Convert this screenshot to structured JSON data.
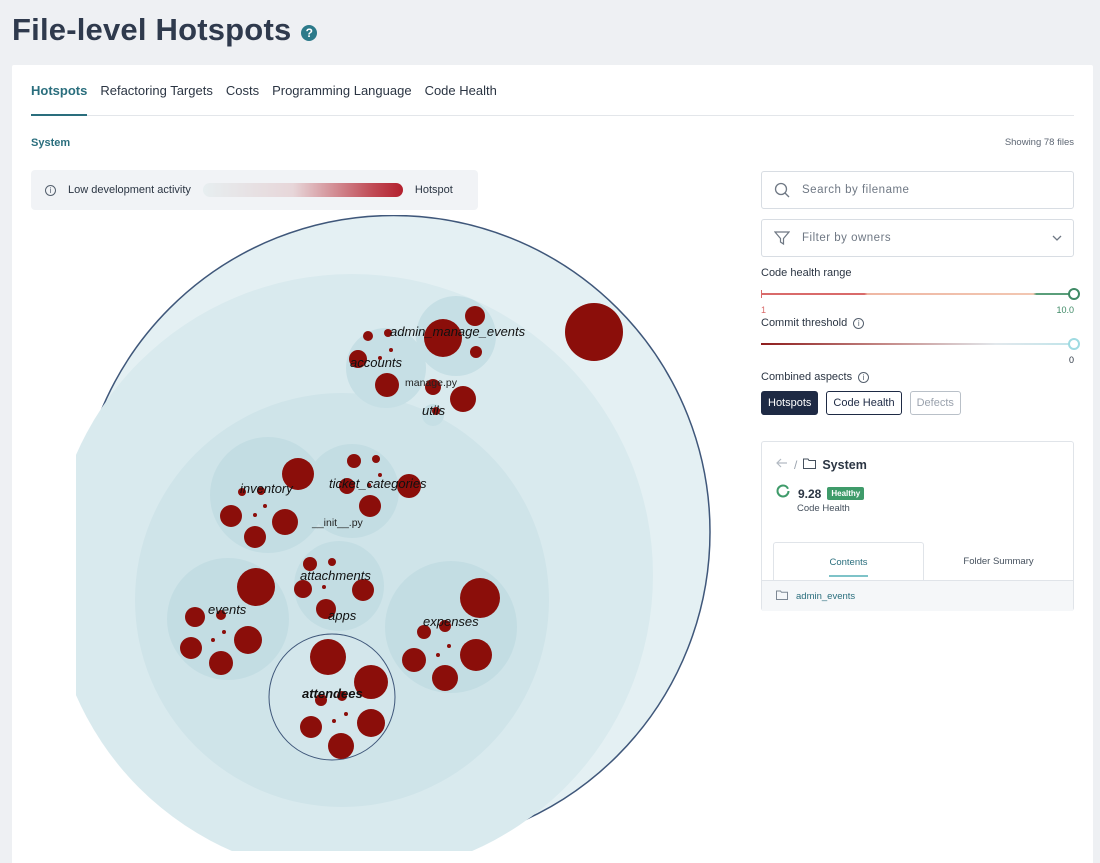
{
  "page": {
    "title": "File-level Hotspots"
  },
  "tabs": [
    {
      "label": "Hotspots",
      "active": true
    },
    {
      "label": "Refactoring Targets",
      "active": false
    },
    {
      "label": "Costs",
      "active": false
    },
    {
      "label": "Programming Language",
      "active": false
    },
    {
      "label": "Code Health",
      "active": false
    }
  ],
  "scope": {
    "label": "System",
    "showing": "Showing 78 files"
  },
  "legend": {
    "low": "Low development activity",
    "high": "Hotspot"
  },
  "visualization": {
    "folder_labels": [
      "admin_manage_events",
      "accounts",
      "manage.py",
      "utils",
      "inventory",
      "ticket_categories",
      "__init__.py",
      "attachments",
      "apps",
      "events",
      "expenses",
      "attendees"
    ],
    "colors": {
      "hotspot": "#8b0e0a",
      "outer_fill": "#e4f0f3",
      "inner_fill": "#d3e6eb",
      "folder_fill": "#c3dde3",
      "outline": "#3f577a"
    }
  },
  "filters": {
    "search_placeholder": "Search by filename",
    "owners_placeholder": "Filter by owners",
    "code_health_range": {
      "label": "Code health range",
      "min": "1",
      "max": "10.0"
    },
    "commit_threshold": {
      "label": "Commit threshold",
      "value": "0"
    },
    "combined_aspects": {
      "label": "Combined aspects",
      "options": [
        {
          "label": "Hotspots",
          "state": "selected"
        },
        {
          "label": "Code Health",
          "state": "enabled"
        },
        {
          "label": "Defects",
          "state": "disabled"
        }
      ]
    }
  },
  "system_card": {
    "name": "System",
    "score": "9.28",
    "badge": "Healthy",
    "score_label": "Code Health",
    "subtabs": [
      "Contents",
      "Folder Summary"
    ],
    "folder": "admin_events"
  }
}
